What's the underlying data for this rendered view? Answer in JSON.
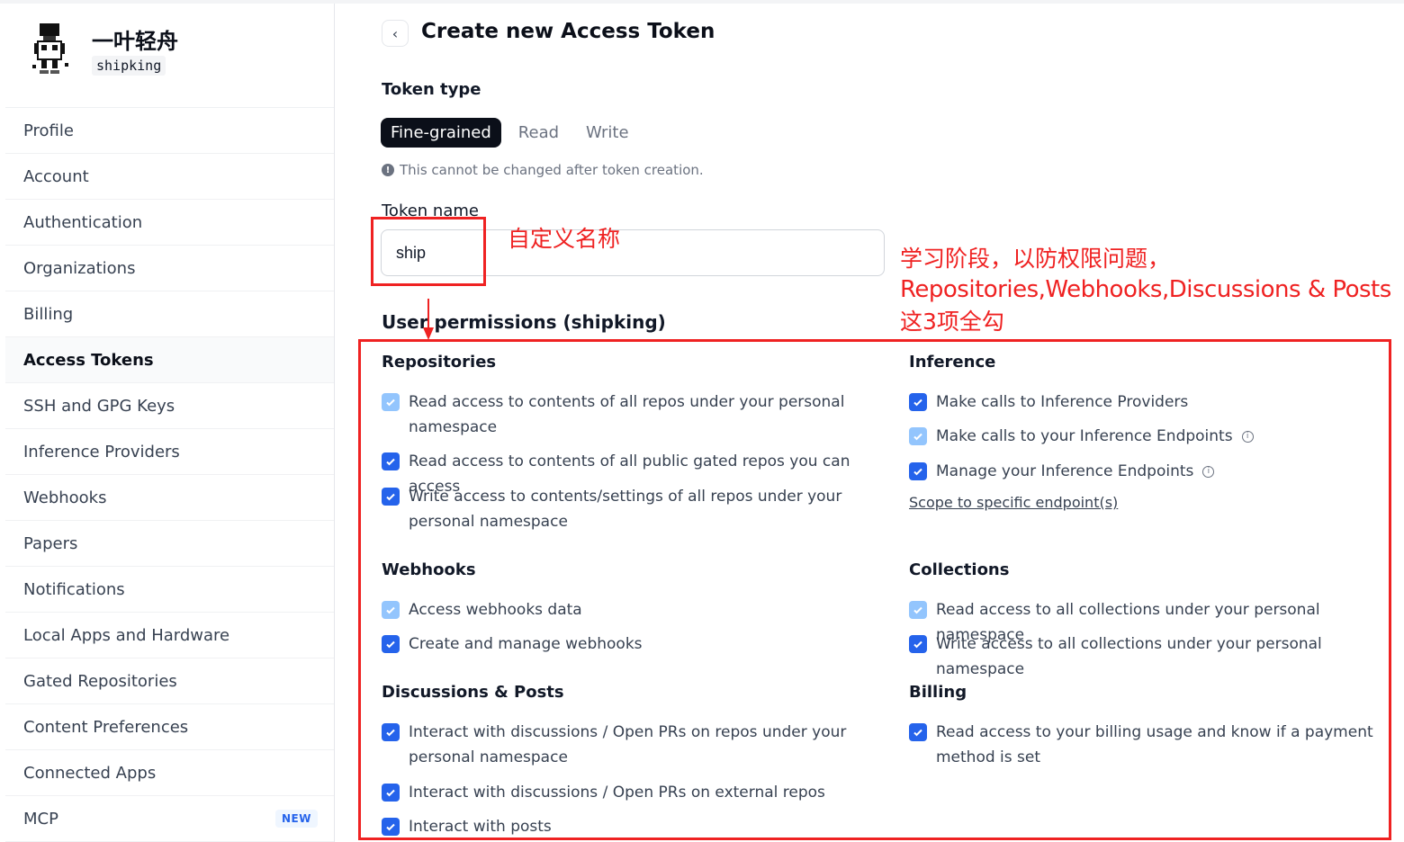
{
  "user": {
    "display_name": "一叶轻舟",
    "handle": "shipking"
  },
  "sidebar": {
    "items": [
      {
        "label": "Profile"
      },
      {
        "label": "Account"
      },
      {
        "label": "Authentication"
      },
      {
        "label": "Organizations"
      },
      {
        "label": "Billing"
      },
      {
        "label": "Access Tokens",
        "active": true
      },
      {
        "label": "SSH and GPG Keys"
      },
      {
        "label": "Inference Providers"
      },
      {
        "label": "Webhooks"
      },
      {
        "label": "Papers"
      },
      {
        "label": "Notifications"
      },
      {
        "label": "Local Apps and Hardware"
      },
      {
        "label": "Gated Repositories"
      },
      {
        "label": "Content Preferences"
      },
      {
        "label": "Connected Apps"
      },
      {
        "label": "MCP",
        "badge": "NEW"
      }
    ]
  },
  "header": {
    "back_icon": "chevron-left-icon",
    "title": "Create new Access Token"
  },
  "token_type": {
    "label": "Token type",
    "tabs": [
      "Fine-grained",
      "Read",
      "Write"
    ],
    "selected": "Fine-grained",
    "note": "This cannot be changed after token creation."
  },
  "token_name": {
    "label": "Token name",
    "value": "ship"
  },
  "permissions": {
    "title": "User permissions (shipking)",
    "repositories": {
      "title": "Repositories",
      "items": [
        "Read access to contents of all repos under your personal namespace",
        "Read access to contents of all public gated repos you can access",
        "Write access to contents/settings of all repos under your personal namespace"
      ]
    },
    "webhooks": {
      "title": "Webhooks",
      "items": [
        "Access webhooks data",
        "Create and manage webhooks"
      ]
    },
    "discussions": {
      "title": "Discussions & Posts",
      "items": [
        "Interact with discussions / Open PRs on repos under your personal namespace",
        "Interact with discussions / Open PRs on external repos",
        "Interact with posts"
      ]
    },
    "inference": {
      "title": "Inference",
      "items": [
        "Make calls to Inference Providers",
        "Make calls to your Inference Endpoints",
        "Manage your Inference Endpoints"
      ],
      "scope_link": "Scope to specific endpoint(s)"
    },
    "collections": {
      "title": "Collections",
      "items": [
        "Read access to all collections under your personal namespace",
        "Write access to all collections under your personal namespace"
      ]
    },
    "billing": {
      "title": "Billing",
      "items": [
        "Read access to your billing usage and know if a payment method is set"
      ]
    }
  },
  "annotations": {
    "name_note": "自定义名称",
    "perm_note_line1": "学习阶段，以防权限问题，",
    "perm_note_line2": "Repositories,Webhooks,Discussions & Posts",
    "perm_note_line3": "这3项全勾",
    "color": "#ef2222"
  },
  "colors": {
    "accent": "#2563eb",
    "checkbox_disabled": "#93c5fd",
    "tab_active_bg": "#0b0f19"
  }
}
